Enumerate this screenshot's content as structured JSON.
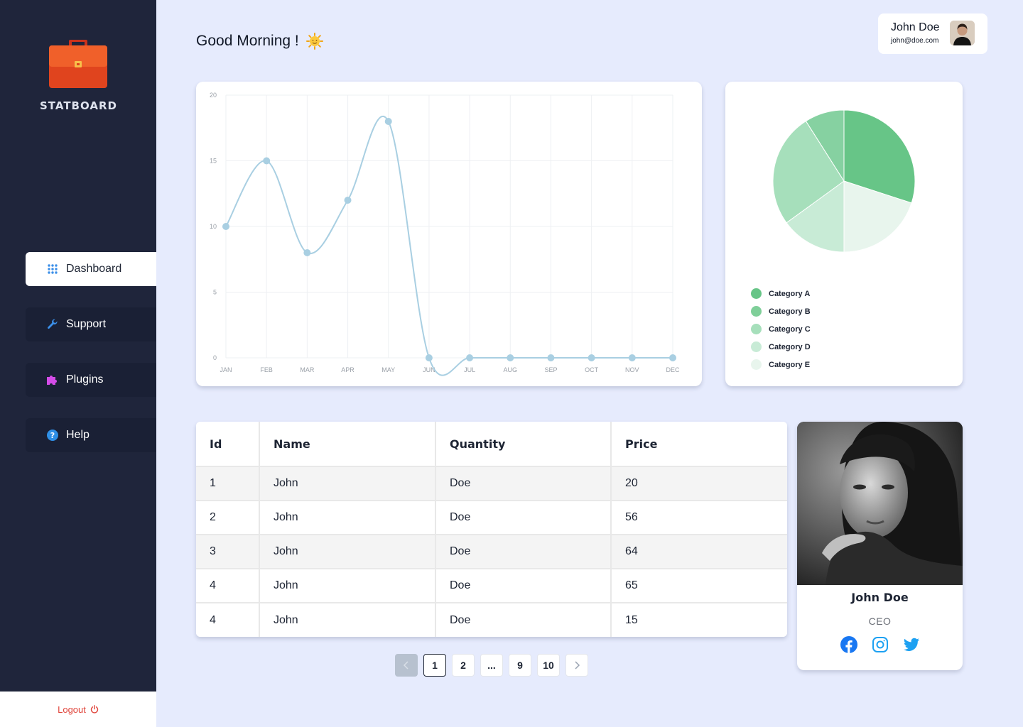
{
  "brand": {
    "name": "STATBOARD",
    "logo_icon": "briefcase-icon"
  },
  "nav": [
    {
      "label": "Dashboard",
      "icon": "grid-icon",
      "active": true
    },
    {
      "label": "Support",
      "icon": "wrench-icon",
      "active": false
    },
    {
      "label": "Plugins",
      "icon": "puzzle-icon",
      "active": false
    },
    {
      "label": "Help",
      "icon": "help-icon",
      "active": false
    }
  ],
  "logout": {
    "label": "Logout",
    "icon": "power-icon"
  },
  "header": {
    "greeting": "Good Morning !",
    "greeting_icon": "sun-icon"
  },
  "user": {
    "name": "John Doe",
    "email": "john@doe.com"
  },
  "line_chart": {
    "chart_data": {
      "type": "line",
      "categories": [
        "JAN",
        "FEB",
        "MAR",
        "APR",
        "MAY",
        "JUN",
        "JUL",
        "AUG",
        "SEP",
        "OCT",
        "NOV",
        "DEC"
      ],
      "series": [
        {
          "values": [
            10,
            15,
            8,
            12,
            18,
            0,
            0,
            0,
            0,
            0,
            0,
            0
          ]
        }
      ],
      "yticks": [
        0,
        5,
        10,
        15,
        20
      ],
      "ylim": [
        0,
        20
      ],
      "grid": true,
      "color": "#a9cfe2"
    }
  },
  "pie_chart": {
    "chart_data": {
      "type": "pie",
      "categories": [
        "Category A",
        "Category B",
        "Category C",
        "Category D",
        "Category E"
      ],
      "values": [
        30,
        20,
        15,
        26,
        9
      ],
      "colors": [
        "#67c587",
        "#e8f5ed",
        "#c8ebd6",
        "#a6dfbb",
        "#86d1a1"
      ],
      "legend_colors": [
        "#67c587",
        "#7fcf99",
        "#a6dfbb",
        "#c8ebd6",
        "#e8f5ed"
      ],
      "legend_position": "bottom-left"
    }
  },
  "table": {
    "headers": [
      "Id",
      "Name",
      "Quantity",
      "Price"
    ],
    "rows": [
      [
        "1",
        "John",
        "Doe",
        "20"
      ],
      [
        "2",
        "John",
        "Doe",
        "56"
      ],
      [
        "3",
        "John",
        "Doe",
        "64"
      ],
      [
        "4",
        "John",
        "Doe",
        "65"
      ],
      [
        "4",
        "John",
        "Doe",
        "15"
      ]
    ]
  },
  "pagination": {
    "pages": [
      "1",
      "2",
      "...",
      "9",
      "10"
    ],
    "current": "1"
  },
  "profile": {
    "name": "John Doe",
    "role": "CEO",
    "socials": [
      "facebook-icon",
      "instagram-icon",
      "twitter-icon"
    ]
  }
}
